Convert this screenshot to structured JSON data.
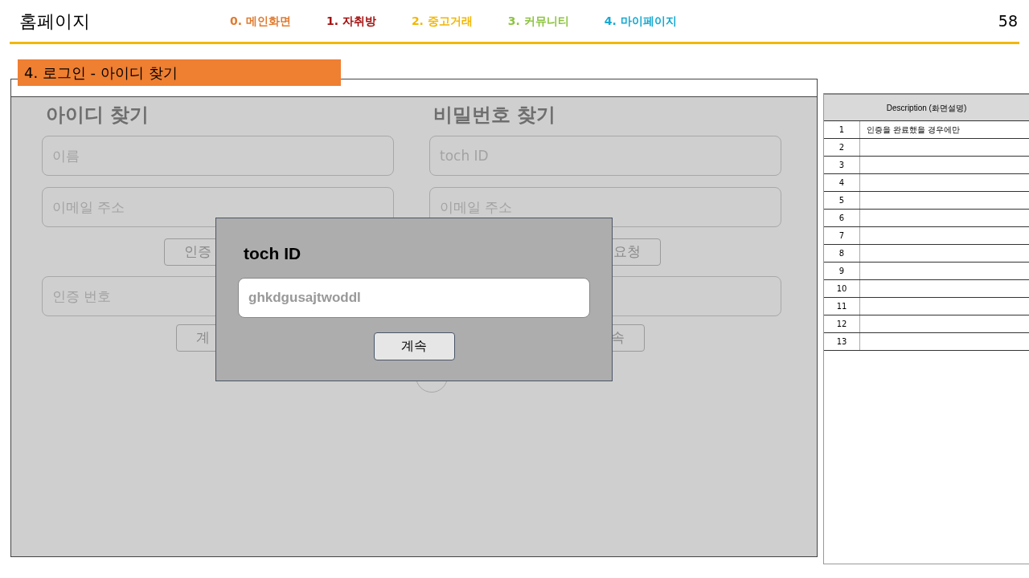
{
  "header": {
    "title": "홈페이지",
    "page_number": "58",
    "nav": [
      {
        "label": "0. 메인화면",
        "color": "#e07b30"
      },
      {
        "label": "1. 자취방",
        "color": "#a50e0e"
      },
      {
        "label": "2. 중고거래",
        "color": "#f2b705"
      },
      {
        "label": "3. 커뮤니티",
        "color": "#8cc43f"
      },
      {
        "label": "4. 마이페이지",
        "color": "#17a9d1"
      }
    ]
  },
  "section_title": "4. 로그인 - 아이디 찾기",
  "find_id": {
    "heading": "아이디 찾기",
    "fields": [
      {
        "placeholder": "이름"
      },
      {
        "placeholder": "이메일 주소"
      }
    ],
    "request_button": "인증",
    "code_field": {
      "placeholder": "인증 번호"
    },
    "continue_button": "계"
  },
  "find_password": {
    "heading": "비밀번호 찾기",
    "fields": [
      {
        "placeholder": "toch ID"
      },
      {
        "placeholder": "이메일 주소"
      }
    ],
    "request_button": "요청",
    "continue_button": "속"
  },
  "dialog": {
    "title": "toch ID",
    "value": "ghkdgusajtwoddl",
    "button": "계속"
  },
  "description": {
    "header": "Description (화면설명)",
    "rows": [
      {
        "number": "1",
        "text": "인증을 완료했을 경우에만"
      },
      {
        "number": "2"
      },
      {
        "number": "3"
      },
      {
        "number": "4"
      },
      {
        "number": "5"
      },
      {
        "number": "6"
      },
      {
        "number": "7"
      },
      {
        "number": "8"
      },
      {
        "number": "9"
      },
      {
        "number": "10"
      },
      {
        "number": "11"
      },
      {
        "number": "12"
      },
      {
        "number": "13"
      }
    ]
  }
}
